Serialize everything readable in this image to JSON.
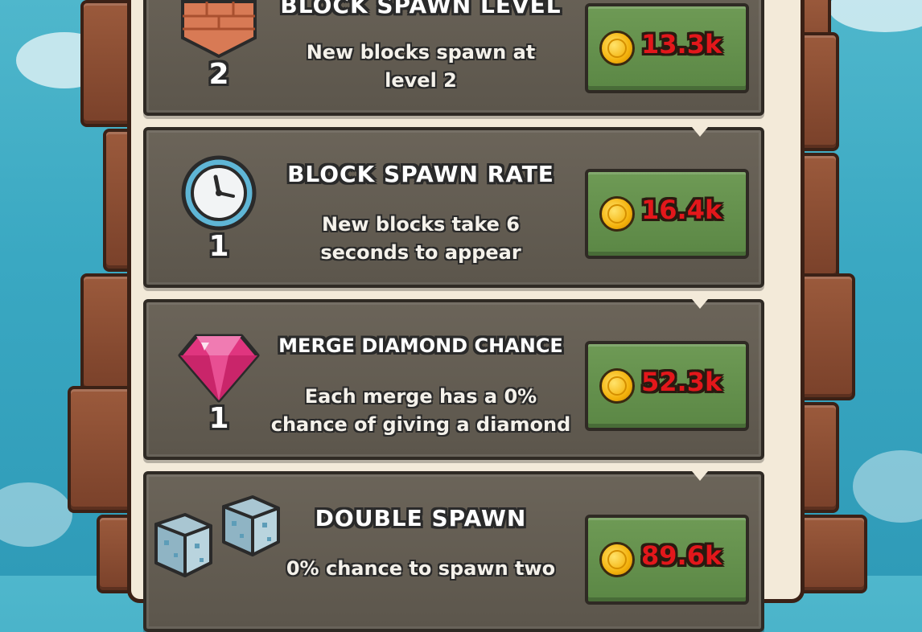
{
  "upgrades": [
    {
      "icon": "brick-block-icon",
      "level": "2",
      "title": "BLOCK SPAWN LEVEL",
      "description_lines": [
        "New blocks spawn at",
        "level 2"
      ],
      "price": "13.3k"
    },
    {
      "icon": "clock-icon",
      "level": "1",
      "title": "BLOCK SPAWN RATE",
      "description_lines": [
        "New blocks take 6",
        "seconds to appear"
      ],
      "price": "16.4k"
    },
    {
      "icon": "diamond-icon",
      "level": "1",
      "title": "MERGE DIAMOND CHANCE",
      "description_lines": [
        "Each merge has a 0%",
        "chance of giving a diamond"
      ],
      "price": "52.3k"
    },
    {
      "icon": "double-block-icon",
      "level": "",
      "title": "DOUBLE SPAWN",
      "description_lines": [
        "0% chance to spawn two"
      ],
      "price": "89.6k"
    }
  ],
  "colors": {
    "price_text": "#e3171b",
    "buy_button": "#6e9a55",
    "card": "#6b6459",
    "frame": "#f3ead9",
    "sky": "#3aa8c2"
  },
  "currency_icon": "coin-icon"
}
